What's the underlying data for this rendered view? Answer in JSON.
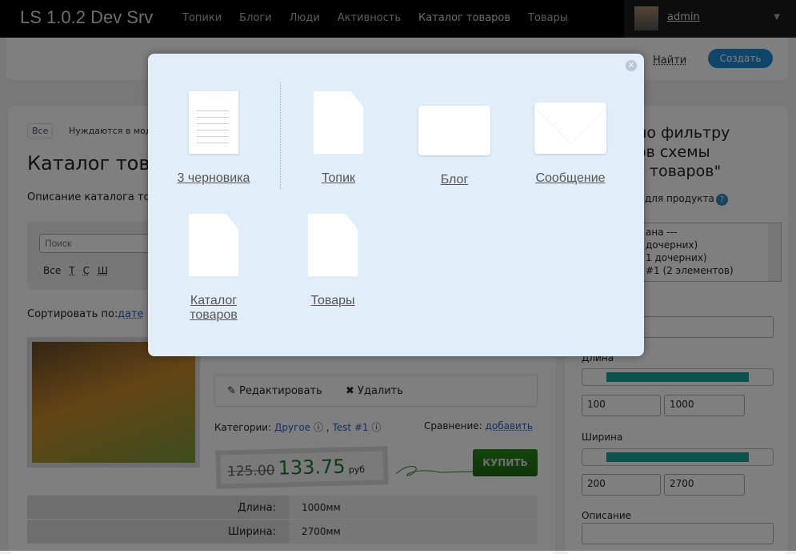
{
  "header": {
    "logo": "LS 1.0.2 Dev Srv",
    "nav": [
      "Топики",
      "Блоги",
      "Люди",
      "Активность",
      "Каталог товаров",
      "Товары"
    ],
    "user": "admin"
  },
  "toolbar": {
    "find": "Найти",
    "create": "Создать"
  },
  "main": {
    "filter_all": "Все",
    "filter_moderation": "Нуждаются в модерации",
    "title": "Каталог товаров",
    "description": "Описание каталога товаров",
    "search_placeholder": "Поиск",
    "letters": [
      "Все",
      "Т",
      "С",
      "Ш"
    ],
    "sort_label": "Сортировать по:",
    "sort_value": "дате",
    "product": {
      "edit": "Редактировать",
      "delete": "Удалить",
      "categories_label": "Категории:",
      "categories": [
        "Другое",
        "Test #1"
      ],
      "compare_label": "Сравнение:",
      "compare_link": "добавить",
      "old_price": "125.00",
      "price": "133.75",
      "currency": "руб",
      "buy": "КУПИТЬ",
      "props": [
        {
          "name": "Длина:",
          "value": "1000мм"
        },
        {
          "name": "Ширина:",
          "value": "2700мм"
        }
      ]
    }
  },
  "sidebar": {
    "title": [
      "по фильтру",
      "ов схемы",
      "г товаров\""
    ],
    "product_label": "для продукта",
    "options": [
      "ана ---",
      "дочерних)",
      "1 дочерних)",
      "#1 (2 элементов)"
    ],
    "length_label": "Длина",
    "length_min": "100",
    "length_max": "1000",
    "width_label": "Ширина",
    "width_min": "200",
    "width_max": "2700",
    "desc_label": "Описание"
  },
  "modal": {
    "items": [
      "3 черновика",
      "Топик",
      "Блог",
      "Сообщение",
      "Каталог товаров",
      "Товары"
    ]
  }
}
